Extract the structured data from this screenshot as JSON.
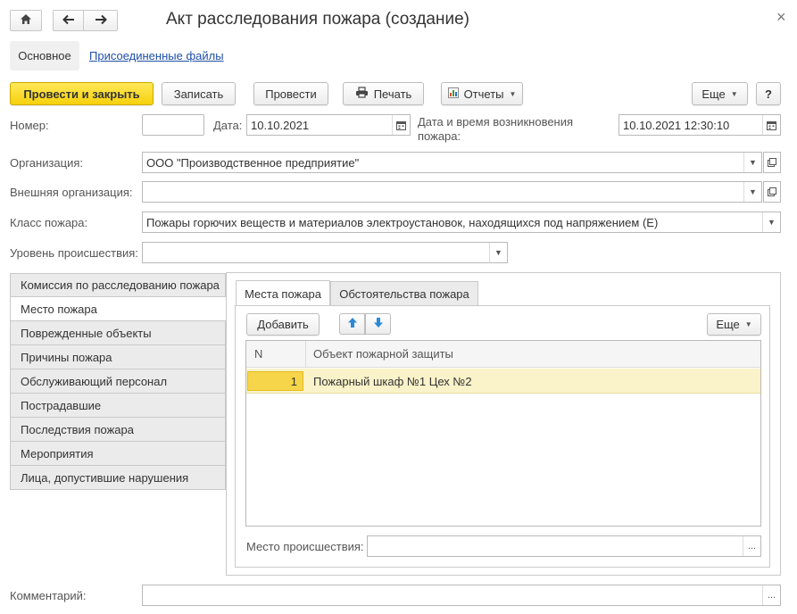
{
  "window": {
    "title": "Акт расследования пожара (создание)"
  },
  "sections": {
    "main": "Основное",
    "files": "Присоединенные файлы"
  },
  "toolbar": {
    "post_close": "Провести и закрыть",
    "save": "Записать",
    "post": "Провести",
    "print": "Печать",
    "reports": "Отчеты",
    "more": "Еще",
    "help": "?"
  },
  "form": {
    "number_label": "Номер:",
    "number_value": "",
    "date_label": "Дата:",
    "date_value": "10.10.2021",
    "fire_datetime_label_1": "Дата и время возникновения",
    "fire_datetime_label_2": "пожара:",
    "fire_datetime_value": "10.10.2021 12:30:10",
    "org_label": "Организация:",
    "org_value": "ООО \"Производственное предприятие\"",
    "ext_org_label": "Внешняя организация:",
    "ext_org_value": "",
    "fire_class_label": "Класс пожара:",
    "fire_class_value": "Пожары горючих веществ и материалов электроустановок, находящихся под напряжением (E)",
    "level_label": "Уровень происшествия:",
    "level_value": "",
    "comment_label": "Комментарий:",
    "comment_value": ""
  },
  "side_tabs": [
    {
      "label": "Комиссия по расследованию пожара",
      "active": false
    },
    {
      "label": "Место пожара",
      "active": true
    },
    {
      "label": "Поврежденные объекты",
      "active": false
    },
    {
      "label": "Причины пожара",
      "active": false
    },
    {
      "label": "Обслуживающий персонал",
      "active": false
    },
    {
      "label": "Пострадавшие",
      "active": false
    },
    {
      "label": "Последствия пожара",
      "active": false
    },
    {
      "label": "Мероприятия",
      "active": false
    },
    {
      "label": "Лица, допустившие нарушения",
      "active": false
    }
  ],
  "inner_tabs": {
    "places": "Места пожара",
    "circumstances": "Обстоятельства пожара"
  },
  "table": {
    "add": "Добавить",
    "more": "Еще",
    "col_n": "N",
    "col_object": "Объект пожарной защиты",
    "rows": [
      {
        "n": "1",
        "object": "Пожарный шкаф №1 Цех №2"
      }
    ]
  },
  "incident_place": {
    "label": "Место происшествия:",
    "value": "",
    "select_button": "..."
  },
  "colors": {
    "primary_button": "#f6d10a",
    "link": "#1f4fa8",
    "selected_row": "#faf2c8",
    "arrow_blue": "#2a8ad8"
  }
}
